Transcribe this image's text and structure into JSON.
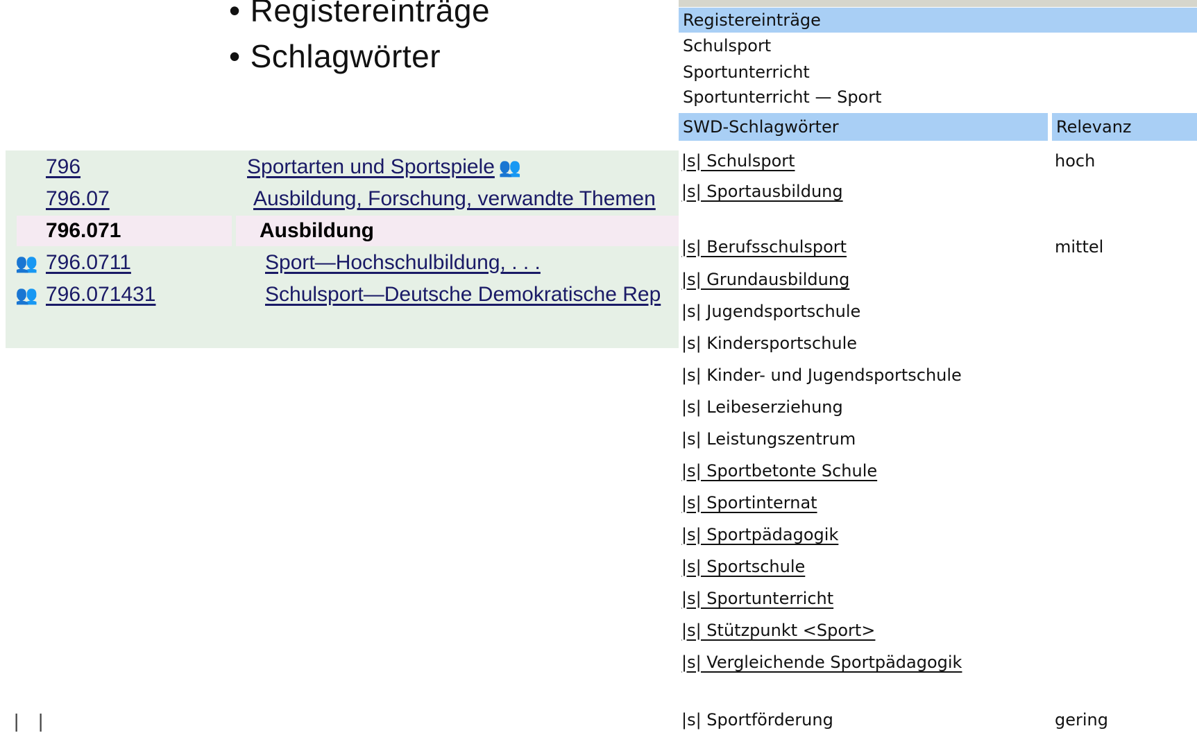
{
  "bullets": [
    "Registereinträge",
    "Schlagwörter"
  ],
  "class_panel": {
    "rows": [
      {
        "number": "796",
        "caption": "Sportarten und Sportspiele",
        "caption_icon": "👥",
        "row_icon": ""
      },
      {
        "number": "796.07",
        "caption": "Ausbildung, Forschung, verwandte Themen",
        "caption_icon": "",
        "row_icon": ""
      },
      {
        "number": "796.071",
        "caption": "Ausbildung",
        "caption_icon": "",
        "row_icon": ""
      },
      {
        "number": "796.0711",
        "caption": "Sport—Hochschulbildung, . . .",
        "caption_icon": "",
        "row_icon": "👥"
      },
      {
        "number": "796.071431",
        "caption": "Schulsport—Deutsche Demokratische Rep",
        "caption_icon": "",
        "row_icon": "👥"
      }
    ]
  },
  "register": {
    "header": "Registereinträge",
    "entries": [
      "Schulsport",
      "Sportunterricht",
      "Sportunterricht — Sport"
    ]
  },
  "swd": {
    "header": "SWD-Schlagwörter",
    "relevance_header": "Relevanz",
    "keywords": [
      {
        "text": "|s| Schulsport",
        "relevance": "hoch"
      },
      {
        "text": "|s| Sportausbildung",
        "relevance": ""
      },
      {
        "text": "|s| Berufsschulsport",
        "relevance": "mittel"
      },
      {
        "text": "|s| Grundausbildung",
        "relevance": ""
      },
      {
        "text": "|s| Jugendsportschule",
        "relevance": ""
      },
      {
        "text": "|s| Kindersportschule",
        "relevance": ""
      },
      {
        "text": "|s| Kinder- und Jugendsportschule",
        "relevance": ""
      },
      {
        "text": "|s| Leibeserziehung",
        "relevance": ""
      },
      {
        "text": "|s| Leistungszentrum",
        "relevance": ""
      },
      {
        "text": "|s| Sportbetonte Schule",
        "relevance": ""
      },
      {
        "text": "|s| Sportinternat",
        "relevance": ""
      },
      {
        "text": "|s| Sportpädagogik",
        "relevance": ""
      },
      {
        "text": "|s| Sportschule",
        "relevance": ""
      },
      {
        "text": "|s| Sportunterricht",
        "relevance": ""
      },
      {
        "text": "|s| Stützpunkt <Sport>",
        "relevance": ""
      },
      {
        "text": "|s| Vergleichende Sportpädagogik",
        "relevance": ""
      },
      {
        "text": "|s| Sportförderung",
        "relevance": "gering"
      }
    ]
  },
  "corner_marks": "| |"
}
